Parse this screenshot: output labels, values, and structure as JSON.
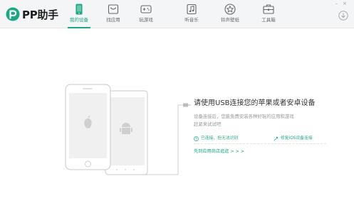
{
  "app": {
    "brand": "PP助手",
    "brand_color": "#1ba784"
  },
  "nav": {
    "items": [
      {
        "label": "我的设备",
        "icon": "phone-icon",
        "active": true
      },
      {
        "label": "找应用",
        "icon": "app-store-icon",
        "active": false
      },
      {
        "label": "玩游戏",
        "icon": "gamepad-icon",
        "active": false
      },
      {
        "label": "听音乐",
        "icon": "music-icon",
        "active": false
      },
      {
        "label": "铃声壁纸",
        "icon": "ringtone-wallpaper-icon",
        "active": false
      },
      {
        "label": "工具箱",
        "icon": "toolbox-icon",
        "active": false
      }
    ]
  },
  "window": {
    "minimize": "–",
    "close": "×"
  },
  "main": {
    "heading": "请使用USB连接您的苹果或者安卓设备",
    "description": [
      "设备连接后，您能免费安装各种好玩的应用和游戏",
      "赶紧来试试吧"
    ],
    "status_left": "已连接，但无法识别",
    "status_right": "修复iOS设备连接",
    "install_link": "先到应用商店逛逛 > > >"
  }
}
